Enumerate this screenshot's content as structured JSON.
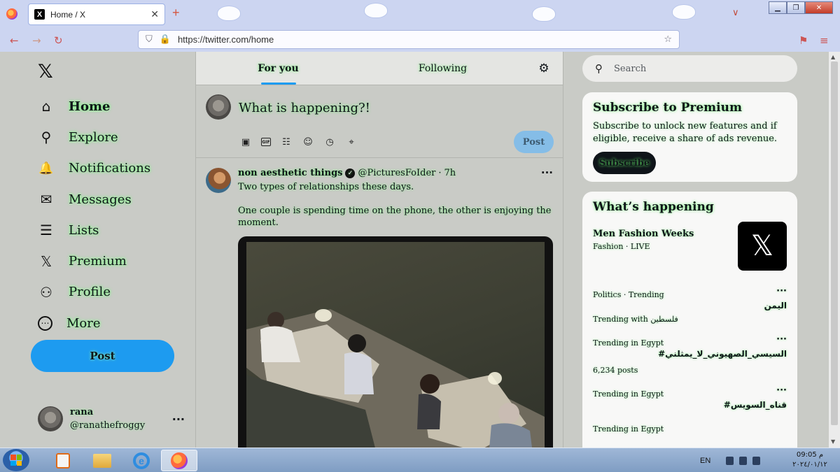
{
  "browser": {
    "tab_title": "Home / X",
    "tab_logo": "X",
    "url": "https://twitter.com/home",
    "icons": [
      "firefox-icon",
      "tab-close-icon",
      "new-tab-icon",
      "list-all-tabs-icon",
      "back-icon",
      "forward-icon",
      "reload-icon",
      "shield-icon",
      "lock-icon",
      "star-icon",
      "extensions-icon",
      "menu-icon"
    ]
  },
  "sidebar": {
    "logo": "𝕏",
    "items": [
      {
        "label": "Home",
        "icon": "home-icon",
        "glyph": "⌂"
      },
      {
        "label": "Explore",
        "icon": "search-icon",
        "glyph": "⚲"
      },
      {
        "label": "Notifications",
        "icon": "bell-icon",
        "glyph": "🔔"
      },
      {
        "label": "Messages",
        "icon": "envelope-icon",
        "glyph": "✉"
      },
      {
        "label": "Lists",
        "icon": "list-icon",
        "glyph": "☰"
      },
      {
        "label": "Premium",
        "icon": "x-logo-icon",
        "glyph": "𝕏"
      },
      {
        "label": "Profile",
        "icon": "person-icon",
        "glyph": "⚇"
      },
      {
        "label": "More",
        "icon": "more-circle-icon",
        "glyph": "⋯"
      }
    ],
    "post_label": "Post",
    "account": {
      "name": "rana",
      "handle": "@ranathefroggy",
      "more": "···"
    }
  },
  "feed": {
    "tabs": [
      {
        "label": "For you",
        "active": true
      },
      {
        "label": "Following",
        "active": false
      }
    ],
    "settings_glyph": "⚙",
    "compose": {
      "placeholder": "What is happening?!",
      "post_label": "Post",
      "tools": [
        "image-icon",
        "gif-icon",
        "poll-icon",
        "emoji-icon",
        "schedule-icon",
        "location-icon"
      ],
      "gif_label": "GIF"
    },
    "tweet": {
      "author": "non aesthetic things",
      "handle": "@PicturesFoIder",
      "separator": "·",
      "time": "7h",
      "more": "···",
      "line1": "Two types of relationships these days.",
      "line2": "One couple is spending time on the phone, the other is enjoying the moment."
    }
  },
  "right": {
    "search_placeholder": "Search",
    "premium": {
      "title": "Subscribe to Premium",
      "text": "Subscribe to unlock new features and if eligible, receive a share of ads revenue.",
      "button": "Subscribe"
    },
    "trends": {
      "title": "What’s happening",
      "feature": {
        "title": "Men Fashion Weeks",
        "meta": "Fashion · LIVE",
        "image": "𝕏"
      },
      "items": [
        {
          "meta": "Politics · Trending",
          "name": "اليمن",
          "more": "···"
        },
        {
          "meta": "Trending with فلسطين",
          "name": "",
          "more": ""
        },
        {
          "meta": "Trending in Egypt",
          "name": "#السيسي_الصهيوني_لا_يمثلني",
          "posts": "6,234 posts",
          "more": "···"
        },
        {
          "meta": "Trending in Egypt",
          "name": "#قناه_السويس",
          "more": "···"
        },
        {
          "meta": "Trending in Egypt",
          "name": "",
          "more": ""
        }
      ]
    }
  },
  "taskbar": {
    "apps": [
      "media-player-icon",
      "folder-icon",
      "internet-explorer-icon",
      "firefox-icon"
    ],
    "active_app": "firefox-icon",
    "language": "EN",
    "clock_time": "09:05 م",
    "clock_date": "٢٠٢٤/٠١/١٢"
  }
}
